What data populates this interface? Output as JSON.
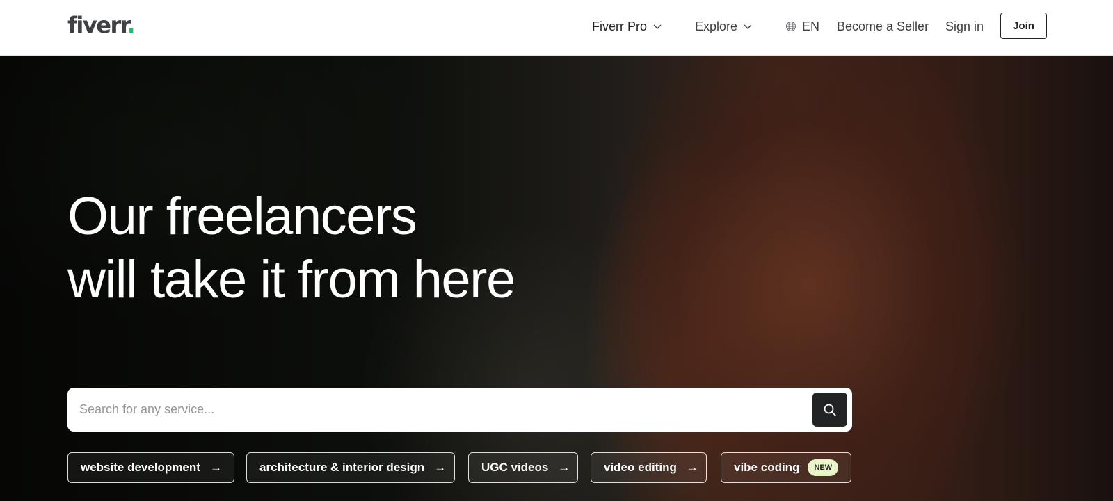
{
  "header": {
    "logo_text": "fiverr",
    "logo_dot": ".",
    "nav": {
      "fiverr_pro": "Fiverr Pro",
      "explore": "Explore",
      "language": "EN",
      "become_seller": "Become a Seller",
      "sign_in": "Sign in",
      "join": "Join"
    }
  },
  "hero": {
    "title_line1": "Our freelancers",
    "title_line2": "will take it from here",
    "search": {
      "placeholder": "Search for any service...",
      "value": ""
    },
    "chips": [
      {
        "label": "website development",
        "arrow": "→"
      },
      {
        "label": "architecture & interior design",
        "arrow": "→"
      },
      {
        "label": "UGC videos",
        "arrow": "→"
      },
      {
        "label": "video editing",
        "arrow": "→"
      },
      {
        "label": "vibe coding",
        "badge": "NEW"
      }
    ]
  },
  "colors": {
    "brand_green": "#1dbf73",
    "text_dark": "#222325",
    "new_badge_bg": "#e8f5c8"
  },
  "icons": [
    "chevron-down-icon",
    "globe-icon",
    "search-icon",
    "arrow-right-icon"
  ]
}
